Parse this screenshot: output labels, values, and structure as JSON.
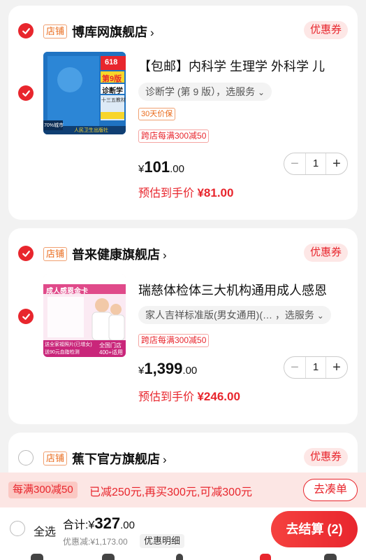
{
  "stores": [
    {
      "tag": "店铺",
      "name": "博库网旗舰店",
      "chevron": "›",
      "coupon": "优惠券",
      "checked": true,
      "product": {
        "title": "【包邮】内科学 生理学 外科学 儿",
        "spec": "诊断学 (第 9 版），选服务",
        "guarantee": "30天价保",
        "promo": "跨店每满300减50",
        "price_currency": "¥",
        "price_int": "101",
        "price_dec": ".00",
        "estimate": "预估到手价 ",
        "estimate_price": "¥81.00",
        "qty": "1",
        "thumb_text": {
          "badge": "618",
          "edition": "第9版",
          "book": "诊断学",
          "sub": "十三五教材",
          "corner": "70%城市",
          "foot": "人民卫生出版社"
        }
      }
    },
    {
      "tag": "店铺",
      "name": "普来健康旗舰店",
      "chevron": "›",
      "coupon": "优惠券",
      "checked": true,
      "product": {
        "title": "瑞慈体检体三大机构通用成人感恩",
        "spec": "家人吉祥标准版(男女通用)(…  ，选服务",
        "promo": "跨店每满300减50",
        "price_currency": "¥",
        "price_int": "1,399",
        "price_dec": ".00",
        "estimate": "预估到手价 ",
        "estimate_price": "¥246.00",
        "qty": "1",
        "thumb_text": {
          "head": "成人感恩金卡",
          "gift": "送全家福照片(已增女)",
          "foot": "送90元血脂检测",
          "store": "全国门店",
          "count": "400+适用"
        }
      }
    },
    {
      "tag": "店铺",
      "name": "蕉下官方旗舰店",
      "chevron": "›",
      "coupon": "优惠券",
      "checked": false
    }
  ],
  "promo_bar": {
    "badge": "每满300减50",
    "text": "已减250元,再买300元,可减300元",
    "button": "去凑单"
  },
  "bottom": {
    "select_all": "全选",
    "total_label": "合计:",
    "total_currency": "¥",
    "total_int": "327",
    "total_dec": ".00",
    "discount": "优惠减:¥1,173.00",
    "detail_button": "优惠明细",
    "checkout": "去结算 (2)"
  },
  "colors": {
    "accent": "#e8262d",
    "store_tag": "#ea6b1c",
    "promo_bg": "#fce6e4"
  }
}
